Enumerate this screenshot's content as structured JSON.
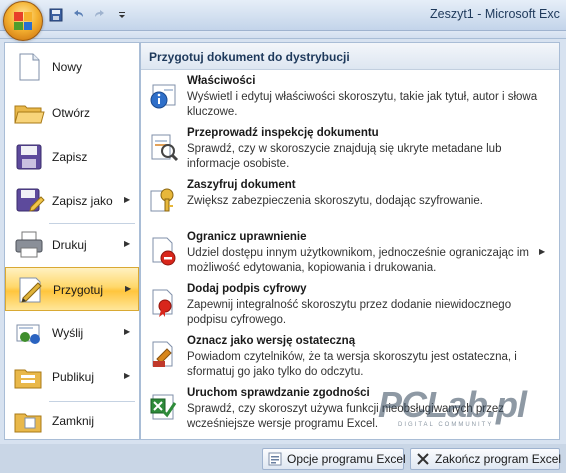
{
  "window": {
    "title": "Zeszyt1 - Microsoft Exc"
  },
  "qat": {
    "icons": [
      "save-icon",
      "undo-icon",
      "redo-icon",
      "customize-icon"
    ]
  },
  "left_menu": {
    "items": [
      {
        "label": "Nowy",
        "icon": "new-document-icon",
        "has_arrow": false
      },
      {
        "label": "Otwórz",
        "icon": "open-folder-icon",
        "has_arrow": false
      },
      {
        "label": "Zapisz",
        "icon": "save-icon",
        "has_arrow": false
      },
      {
        "label": "Zapisz jako",
        "icon": "save-as-icon",
        "has_arrow": true
      },
      {
        "label": "Drukuj",
        "icon": "printer-icon",
        "has_arrow": true
      },
      {
        "label": "Przygotuj",
        "icon": "prepare-icon",
        "has_arrow": true,
        "active": true
      },
      {
        "label": "Wyślij",
        "icon": "send-icon",
        "has_arrow": true
      },
      {
        "label": "Publikuj",
        "icon": "publish-icon",
        "has_arrow": true
      },
      {
        "label": "Zamknij",
        "icon": "close-folder-icon",
        "has_arrow": false
      }
    ]
  },
  "submenu": {
    "header": "Przygotuj dokument do dystrybucji",
    "items": [
      {
        "title": "Właściwości",
        "description": "Wyświetl i edytuj właściwości skoroszytu, takie jak tytuł, autor i słowa kluczowe.",
        "icon": "properties-icon"
      },
      {
        "title": "Przeprowadź inspekcję dokumentu",
        "description": "Sprawdź, czy w skoroszycie znajdują się ukryte metadane lub informacje osobiste.",
        "icon": "inspect-document-icon"
      },
      {
        "title": "Zaszyfruj dokument",
        "description": "Zwiększ zabezpieczenia  skoroszytu, dodając szyfrowanie.",
        "icon": "encrypt-key-icon"
      },
      {
        "title": "Ogranicz uprawnienie",
        "description": "Udziel dostępu innym użytkownikom, jednocześnie ograniczając im możliwość edytowania, kopiowania i drukowania.",
        "icon": "restrict-permission-icon",
        "has_arrow": true
      },
      {
        "title": "Dodaj podpis cyfrowy",
        "description": "Zapewnij integralność skoroszytu przez dodanie niewidocznego podpisu cyfrowego.",
        "icon": "digital-signature-icon"
      },
      {
        "title": "Oznacz jako wersję ostateczną",
        "description": "Powiadom czytelników, że ta wersja skoroszytu jest ostateczna, i sformatuj go jako tylko do odczytu.",
        "icon": "mark-final-icon"
      },
      {
        "title": "Uruchom sprawdzanie zgodności",
        "description": "Sprawdź, czy skoroszyt używa funkcji nieobsługiwanych przez wcześniejsze wersje programu Excel.",
        "icon": "compatibility-checker-icon"
      }
    ]
  },
  "bottom": {
    "options_label": "Opcje programu Excel",
    "exit_label": "Zakończ program Excel"
  },
  "watermark": {
    "main": "PCLab.pl",
    "sub": "DIGITAL COMMUNITY"
  },
  "colors": {
    "active_highlight": "#ffd86b",
    "frame_blue": "#a9bdd6",
    "title_text": "#1e395b"
  }
}
